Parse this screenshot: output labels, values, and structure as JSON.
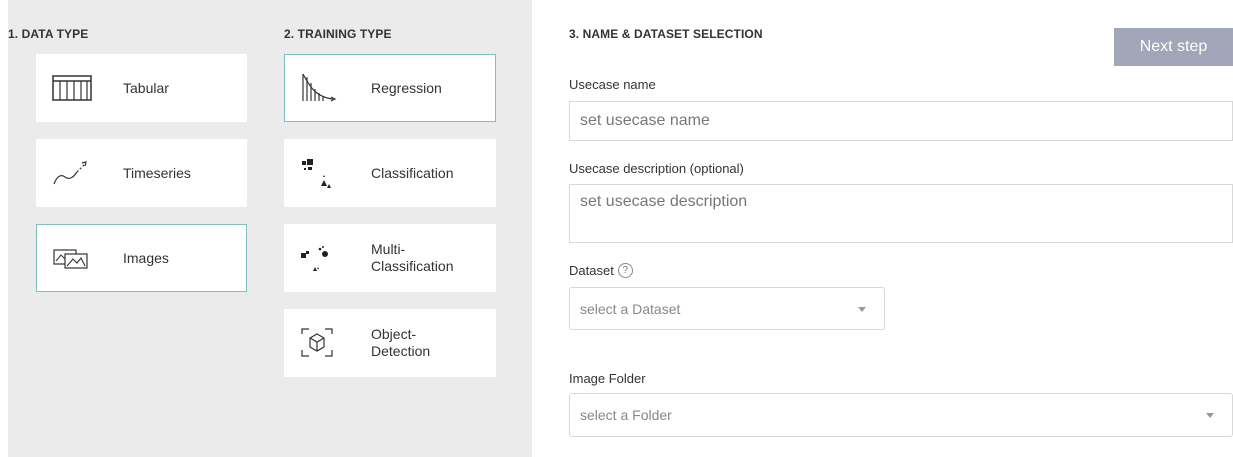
{
  "data_type": {
    "title": "1. DATA TYPE",
    "options": [
      {
        "label": "Tabular",
        "icon": "table-icon",
        "selected": false
      },
      {
        "label": "Timeseries",
        "icon": "timeseries-icon",
        "selected": false
      },
      {
        "label": "Images",
        "icon": "images-icon",
        "selected": true
      }
    ]
  },
  "training_type": {
    "title": "2. TRAINING TYPE",
    "options": [
      {
        "label": "Regression",
        "icon": "regression-icon",
        "selected": true
      },
      {
        "label": "Classification",
        "icon": "classification-icon",
        "selected": false
      },
      {
        "label": "Multi-\nClassification",
        "icon": "multi-classification-icon",
        "selected": false
      },
      {
        "label": "Object-\nDetection",
        "icon": "object-detection-icon",
        "selected": false
      }
    ]
  },
  "name_dataset": {
    "title": "3. NAME & DATASET SELECTION",
    "next_button": "Next step",
    "usecase_name_label": "Usecase name",
    "usecase_name_placeholder": "set usecase name",
    "usecase_desc_label": "Usecase description (optional)",
    "usecase_desc_placeholder": "set usecase description",
    "dataset_label": "Dataset",
    "dataset_help": "?",
    "dataset_placeholder": "select a Dataset",
    "image_folder_label": "Image Folder",
    "image_folder_placeholder": "select a Folder"
  },
  "colors": {
    "panel_bg": "#ebebeb",
    "selected_border": "#7fbfbf",
    "button_bg": "#a1a7b9"
  }
}
